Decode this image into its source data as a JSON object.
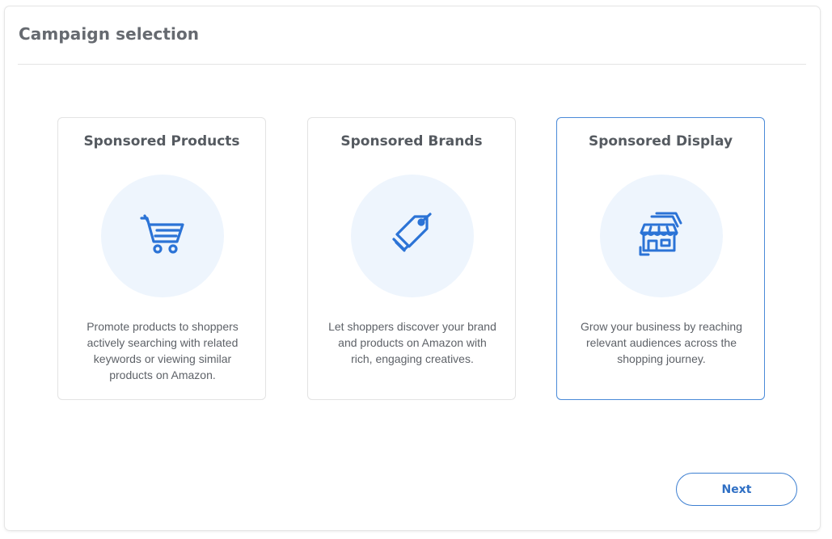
{
  "header": {
    "title": "Campaign selection"
  },
  "cards": [
    {
      "title": "Sponsored Products",
      "icon": "shopping-cart-icon",
      "description": "Promote products to shoppers actively searching with related keywords or viewing similar products on Amazon.",
      "selected": false
    },
    {
      "title": "Sponsored Brands",
      "icon": "price-tag-icon",
      "description": "Let shoppers discover your brand and products on Amazon with rich, engaging creatives.",
      "selected": false
    },
    {
      "title": "Sponsored Display",
      "icon": "storefront-icon",
      "description": "Grow your business by reaching relevant audiences across the shopping journey.",
      "selected": true
    }
  ],
  "footer": {
    "next_label": "Next"
  },
  "colors": {
    "accent": "#2f6fc4",
    "icon": "#2b73d6",
    "icon_background": "#eef5fd",
    "selected_border": "#4a8ad8"
  }
}
